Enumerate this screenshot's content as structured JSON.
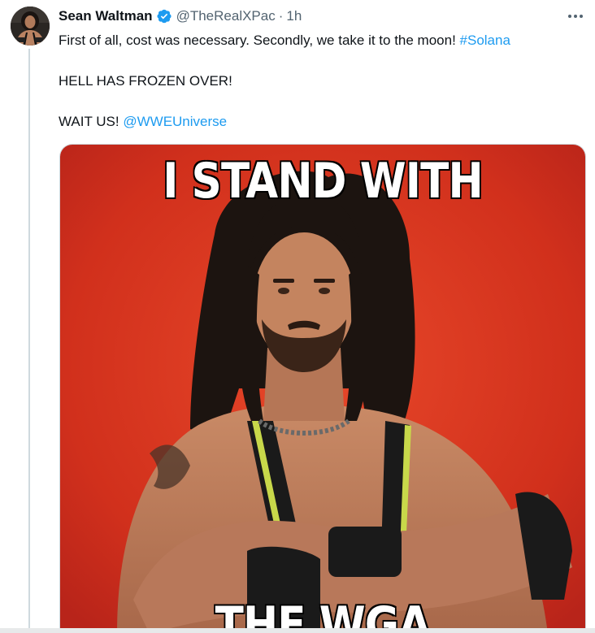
{
  "tweet": {
    "author": {
      "display_name": "Sean Waltman",
      "handle": "@TheRealXPac",
      "verified": true
    },
    "separator": "·",
    "timestamp": "1h",
    "more_icon": "more-horizontal-icon",
    "text": {
      "line1_prefix": "First of all, cost was necessary. Secondly, we take it to the moon! ",
      "line1_hashtag": "#Solana",
      "line2": "HELL HAS FROZEN OVER!",
      "line3_prefix": "WAIT US! ",
      "line3_mention": "@WWEUniverse"
    },
    "media": {
      "top_caption": "I STAND WITH",
      "bottom_caption": "THE WGA"
    }
  },
  "colors": {
    "link": "#1d9bf0",
    "text": "#0f1419",
    "secondary": "#536471",
    "verified": "#1d9bf0",
    "meme_background": "#d9341f"
  }
}
